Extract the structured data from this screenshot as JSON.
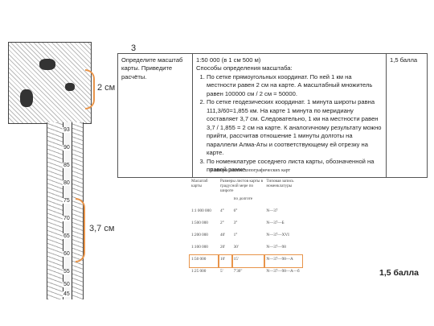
{
  "number": "3",
  "map": {
    "scale_label_top": "2 см",
    "scale_label_bottom": "3,7 см",
    "ruler_ticks": [
      "45",
      "50",
      "55",
      "60",
      "65",
      "70",
      "75",
      "80",
      "85",
      "90",
      "93"
    ]
  },
  "task": {
    "question": "Определите масштаб карты. Приведите расчёты.",
    "answer_title": "1:50 000 (в 1 см 500 м)",
    "methods_title": "Способы определения масштаба:",
    "methods": [
      "По сетке прямоугольных координат. По ней 1 км на местности равен 2 см на карте. А масштабный множитель равен 100000 см / 2 см = 50000.",
      "По сетке геодезических координат. 1 минута широты равна 111,3/60=1,855 км. На карте 1 минута по меридиану составляет 3,7 см. Следовательно, 1 км на местности равен 3,7 / 1,855 = 2 см на карте. К аналогичному результату можно прийти, рассчитав отношение 1 минуты долготы на параллели Алма-Аты и соответствующему ей отрезку на карте.",
      "По номенклатуре соседнего листа карты, обозначенной на правой рамке."
    ],
    "points": "1,5 балла"
  },
  "reference": {
    "title": "Размеры листов топографических карт",
    "headers": [
      "Масштаб карты",
      "Размеры листов карты в градусной мере по широте",
      "по долготе",
      "Типовая запись номенклатуры"
    ],
    "rows": [
      [
        "1:1 000 000",
        "4°",
        "6°",
        "N—37"
      ],
      [
        "1:500 000",
        "2°",
        "3°",
        "N—37—Б"
      ],
      [
        "1:200 000",
        "40'",
        "1°",
        "N—37—XVI"
      ],
      [
        "1:100 000",
        "20'",
        "30'",
        "N—37—98"
      ],
      [
        "1:50 000",
        "10'",
        "15'",
        "N—37—98—А"
      ],
      [
        "1:25 000",
        "5'",
        "7'30\"",
        "N—37—98—А—б"
      ]
    ]
  },
  "grade": "1,5 балла"
}
